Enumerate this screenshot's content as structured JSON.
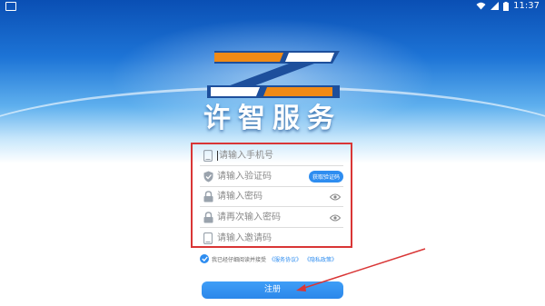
{
  "status_bar": {
    "time": "11:37"
  },
  "brand": {
    "title": "许智服务"
  },
  "form": {
    "phone_placeholder": "请输入手机号",
    "code_placeholder": "请输入验证码",
    "get_code_label": "获取验证码",
    "password_placeholder": "请输入密码",
    "confirm_password_placeholder": "请再次输入密码",
    "invite_code_placeholder": "请输入邀请码"
  },
  "agreement": {
    "text": "我已经仔细阅读并接受",
    "service_link": "《服务协议》",
    "privacy_link": "《隐私政策》"
  },
  "register_label": "注册",
  "colors": {
    "accent": "#2e8df0",
    "annotation_red": "#d93636",
    "logo_blue": "#1d4f9c",
    "logo_orange": "#f08a16"
  }
}
